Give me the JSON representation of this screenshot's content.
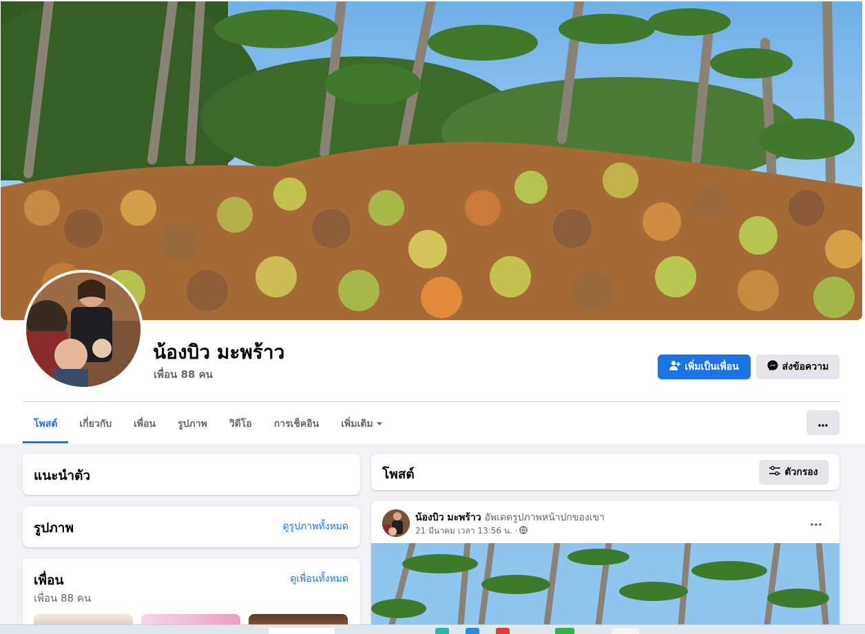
{
  "profile": {
    "name": "น้องบิว มะพร้าว",
    "friend_count": "เพื่อน 88 คน",
    "add_friend_label": "เพิ่มเป็นเพื่อน",
    "message_label": "ส่งข้อความ"
  },
  "tabs": [
    {
      "label": "โพสต์",
      "active": true
    },
    {
      "label": "เกี่ยวกับ"
    },
    {
      "label": "เพื่อน"
    },
    {
      "label": "รูปภาพ"
    },
    {
      "label": "วิดีโอ"
    },
    {
      "label": "การเช็คอิน"
    },
    {
      "label": "เพิ่มเติม"
    }
  ],
  "sidebar": {
    "intro_title": "แนะนำตัว",
    "photos_title": "รูปภาพ",
    "photos_link": "ดูรูปภาพทั้งหมด",
    "friends_title": "เพื่อน",
    "friends_link": "ดูเพื่อนทั้งหมด",
    "friends_count": "เพื่อน 88 คน"
  },
  "posts_section": {
    "title": "โพสต์",
    "filter_label": "ตัวกรอง"
  },
  "post": {
    "author": "น้องบิว มะพร้าว",
    "action": "อัพเดตรูปภาพหน้าปกของเขา",
    "timestamp": "21 มีนาคม เวลา 13:56 น. ·"
  },
  "colors": {
    "primary": "#1b74e4",
    "page_bg": "#f0f2f5",
    "secondary_btn": "#e4e6eb"
  },
  "icons": {
    "add_friend": "person-plus-icon",
    "message": "messenger-icon",
    "tab_dropdown": "caret-down-icon",
    "more": "more-horizontal-icon",
    "filter": "filter-sliders-icon",
    "audience": "globe-icon"
  }
}
